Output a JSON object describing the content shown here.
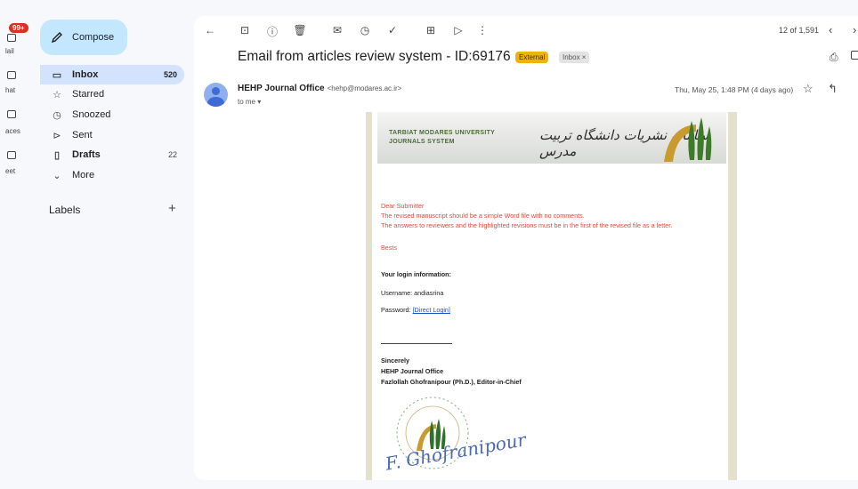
{
  "rail": {
    "badge": "99+",
    "items": [
      {
        "label": "lail"
      },
      {
        "label": "hat"
      },
      {
        "label": "aces"
      },
      {
        "label": "eet"
      }
    ]
  },
  "sidebar": {
    "compose_label": "Compose",
    "items": [
      {
        "label": "Inbox",
        "count": "520",
        "icon": "inbox-icon"
      },
      {
        "label": "Starred",
        "count": "",
        "icon": "star-icon"
      },
      {
        "label": "Snoozed",
        "count": "",
        "icon": "clock-icon"
      },
      {
        "label": "Sent",
        "count": "",
        "icon": "send-icon"
      },
      {
        "label": "Drafts",
        "count": "22",
        "icon": "draft-icon"
      },
      {
        "label": "More",
        "count": "",
        "icon": "chevron-down-icon"
      }
    ],
    "labels_heading": "Labels"
  },
  "toolbar": {
    "pager": "12 of 1,591"
  },
  "message": {
    "subject": "Email from articles review system - ID:69176",
    "tag_external": "External",
    "tag_inbox": "Inbox ×",
    "sender_name": "HEHP Journal Office",
    "sender_email": "<hehp@modares.ac.ir>",
    "to": "to me ▾",
    "date": "Thu, May 25, 1:48 PM (4 days ago)"
  },
  "email_body": {
    "banner_en_line1": "TARBIAT MODARES UNIVERSITY",
    "banner_en_line2": "JOURNALS SYSTEM",
    "banner_fa": "سامانه نشریات دانشگاه تربیت مدرس",
    "greeting": "Dear Submitter",
    "line1": "The revised manuscript should be a simple Word file with no comments.",
    "line2": "The answers to reviewers and the highlighted revisions must be in the first of the revised file as a letter.",
    "bests": "Bests",
    "login_heading": "Your login information:",
    "username": "Username: andiasrina",
    "password_label": "Password: ",
    "direct_login": "[Direct Login]",
    "sincerely": "Sincerely",
    "office": "HEHP Journal Office",
    "editor": "Fazlollah Ghofranipour (Ph.D.), Editor-in-Chief",
    "signature": "F. Ghofranipour"
  },
  "colors": {
    "background": "#f6f8fc",
    "compose": "#c2e7ff",
    "active_nav": "#d3e3fd",
    "external_tag": "#f0b400",
    "red_text": "#e04b3c",
    "link": "#1a55c7"
  }
}
